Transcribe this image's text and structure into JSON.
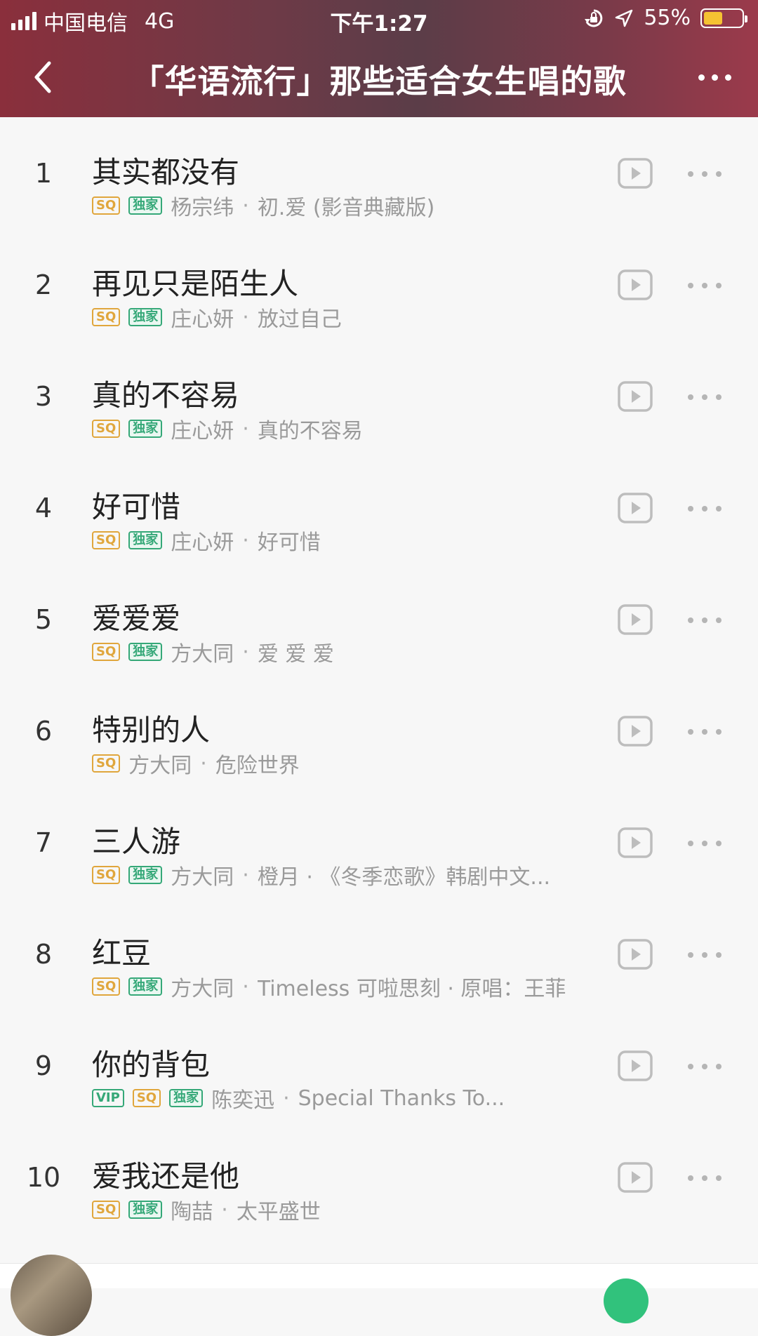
{
  "status_bar": {
    "carrier": "中国电信",
    "network": "4G",
    "time": "下午1:27",
    "battery": "55%"
  },
  "nav": {
    "title": "「华语流行」那些适合女生唱的歌"
  },
  "songs": [
    {
      "index": "1",
      "title": "其实都没有",
      "badges": [
        "SQ",
        "独家"
      ],
      "artist": "杨宗纬",
      "album": "初.爱 (影音典藏版)"
    },
    {
      "index": "2",
      "title": "再见只是陌生人",
      "badges": [
        "SQ",
        "独家"
      ],
      "artist": "庄心妍",
      "album": "放过自己"
    },
    {
      "index": "3",
      "title": "真的不容易",
      "badges": [
        "SQ",
        "独家"
      ],
      "artist": "庄心妍",
      "album": "真的不容易"
    },
    {
      "index": "4",
      "title": "好可惜",
      "badges": [
        "SQ",
        "独家"
      ],
      "artist": "庄心妍",
      "album": "好可惜"
    },
    {
      "index": "5",
      "title": "爱爱爱",
      "badges": [
        "SQ",
        "独家"
      ],
      "artist": "方大同",
      "album": "爱 爱 爱"
    },
    {
      "index": "6",
      "title": "特别的人",
      "badges": [
        "SQ"
      ],
      "artist": "方大同",
      "album": "危险世界"
    },
    {
      "index": "7",
      "title": "三人游",
      "badges": [
        "SQ",
        "独家"
      ],
      "artist": "方大同",
      "album": "橙月 · 《冬季恋歌》韩剧中文..."
    },
    {
      "index": "8",
      "title": "红豆",
      "badges": [
        "SQ",
        "独家"
      ],
      "artist": "方大同",
      "album": "Timeless 可啦思刻 · 原唱：王菲"
    },
    {
      "index": "9",
      "title": "你的背包",
      "badges": [
        "VIP",
        "SQ",
        "独家"
      ],
      "artist": "陈奕迅",
      "album": "Special Thanks To..."
    },
    {
      "index": "10",
      "title": "爱我还是他",
      "badges": [
        "SQ",
        "独家"
      ],
      "artist": "陶喆",
      "album": "太平盛世"
    }
  ],
  "icons": {
    "back": "chevron-left-icon",
    "more": "more-horizontal-icon",
    "play": "play-icon",
    "row_more": "more-dots-icon"
  },
  "colors": {
    "sq_badge": "#e0a63c",
    "exclusive_badge": "#35a878",
    "header_gradient_start": "#8a2f3c",
    "header_gradient_end": "#9b3a4b"
  }
}
